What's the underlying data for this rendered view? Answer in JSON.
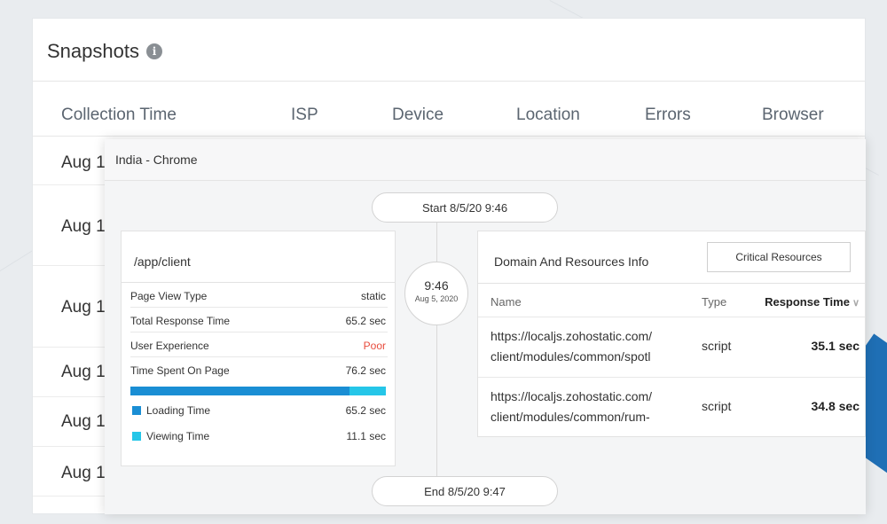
{
  "snapshots": {
    "title": "Snapshots",
    "info_icon": "info-icon",
    "columns": [
      "Collection Time",
      "ISP",
      "Device",
      "Location",
      "Errors",
      "Browser"
    ],
    "rows": [
      "Aug 1",
      "Aug 1",
      "Aug 1",
      "Aug 1",
      "Aug 1",
      "Aug 1"
    ]
  },
  "overlay": {
    "header": "India - Chrome",
    "start": "Start 8/5/20 9:46",
    "end": "End 8/5/20 9:47",
    "circle_time": "9:46",
    "circle_date": "Aug 5, 2020",
    "page": {
      "title": "/app/client",
      "stats": [
        {
          "label": "Page View Type",
          "value": "static"
        },
        {
          "label": "Total Response Time",
          "value": "65.2 sec"
        },
        {
          "label": "User Experience",
          "value": "Poor"
        },
        {
          "label": "Time Spent On Page",
          "value": "76.2 sec"
        }
      ],
      "loading_fraction": 0.856,
      "legend": [
        {
          "label": "Loading Time",
          "value": "65.2 sec",
          "color": "#1a8ed4"
        },
        {
          "label": "Viewing Time",
          "value": "11.1 sec",
          "color": "#25c6e8"
        }
      ]
    },
    "resources": {
      "title": "Domain And Resources Info",
      "button": "Critical Resources",
      "headers": {
        "name": "Name",
        "type": "Type",
        "time": "Response Time"
      },
      "rows": [
        {
          "name1": "https://localjs.zohostatic.com/",
          "name2": "client/modules/common/spotl",
          "type": "script",
          "time": "35.1 sec"
        },
        {
          "name1": "https://localjs.zohostatic.com/",
          "name2": "client/modules/common/rum-",
          "type": "script",
          "time": "34.8 sec"
        }
      ]
    }
  },
  "colors": {
    "poor": "#e84c3d",
    "loading": "#1a8ed4",
    "viewing": "#25c6e8"
  }
}
